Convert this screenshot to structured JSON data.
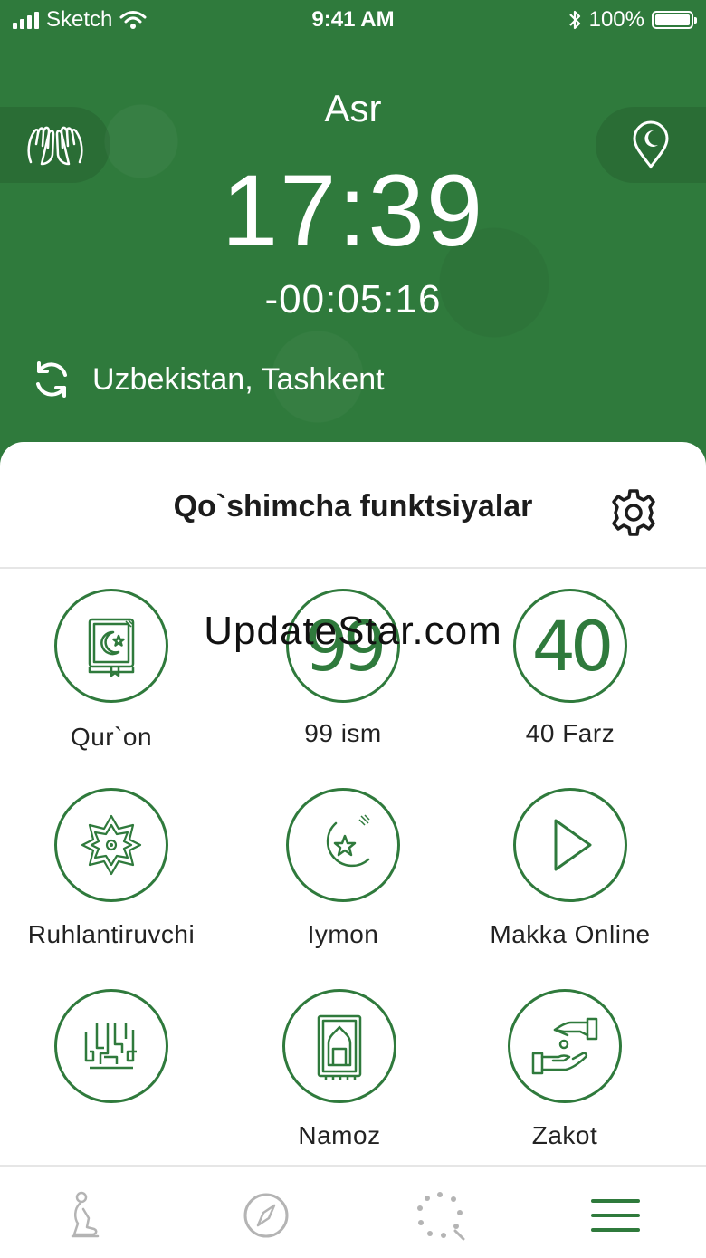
{
  "status_bar": {
    "carrier": "Sketch",
    "time": "9:41 AM",
    "battery": "100%"
  },
  "header": {
    "prayer_name": "Asr",
    "prayer_time": "17:39",
    "countdown": "-00:05:16",
    "location": "Uzbekistan, Tashkent",
    "left_button_icon": "praying-hands-icon",
    "right_button_icon": "location-crescent-icon"
  },
  "sheet": {
    "title": "Qo`shimcha funktsiyalar",
    "settings_icon": "gear-icon",
    "tiles": [
      {
        "label": "Qur`on",
        "icon": "quran-book-icon"
      },
      {
        "label": "99 ism",
        "icon": "ninety-nine-icon",
        "glyph": "99"
      },
      {
        "label": "40 Farz",
        "icon": "forty-icon",
        "glyph": "40"
      },
      {
        "label": "Ruhlantiruvchi",
        "icon": "ornament-icon"
      },
      {
        "label": "Iymon",
        "icon": "crescent-star-icon"
      },
      {
        "label": "Makka Online",
        "icon": "play-icon"
      },
      {
        "label": "",
        "icon": "calligraphy-icon"
      },
      {
        "label": "Namoz",
        "icon": "prayer-rug-icon"
      },
      {
        "label": "Zakot",
        "icon": "giving-hands-icon"
      }
    ]
  },
  "watermark": "UpdateStar.com",
  "tabbar": {
    "items": [
      "prayer-person-icon",
      "compass-icon",
      "loading-dots-icon",
      "menu-icon"
    ]
  },
  "colors": {
    "brand_green": "#2f7a3c",
    "tab_gray": "#b4b4b4"
  }
}
